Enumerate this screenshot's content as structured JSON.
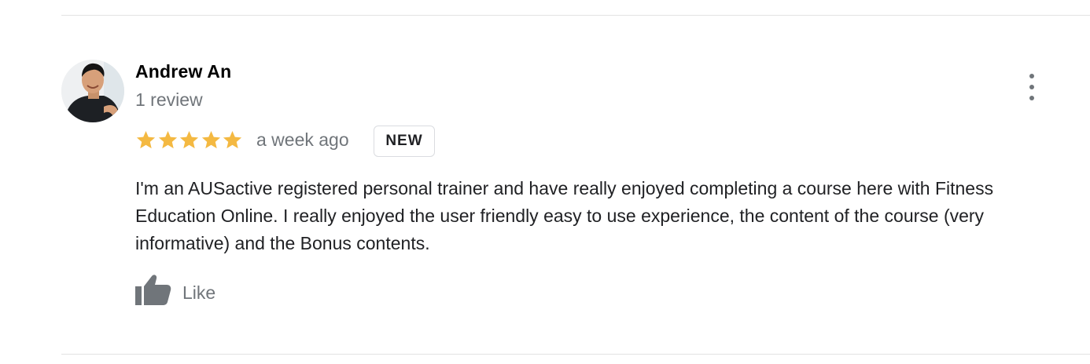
{
  "review": {
    "author_name": "Andrew An",
    "review_count": "1 review",
    "rating": 5,
    "rating_max": 5,
    "time_ago": "a week ago",
    "badge": "NEW",
    "text": "I'm an AUSactive registered personal trainer and have really enjoyed completing a course here with Fitness Education Online. I really enjoyed the user friendly easy to use experience, the content of the course (very informative) and the Bonus contents.",
    "like_label": "Like"
  },
  "icons": {
    "star": "star-icon",
    "more": "more-vert-icon",
    "like": "thumbs-up-icon"
  },
  "colors": {
    "star": "#f4b942",
    "secondary_text": "#70757a",
    "primary_text": "#202124",
    "divider": "#e3e3e3",
    "badge_border": "#dadce0"
  }
}
